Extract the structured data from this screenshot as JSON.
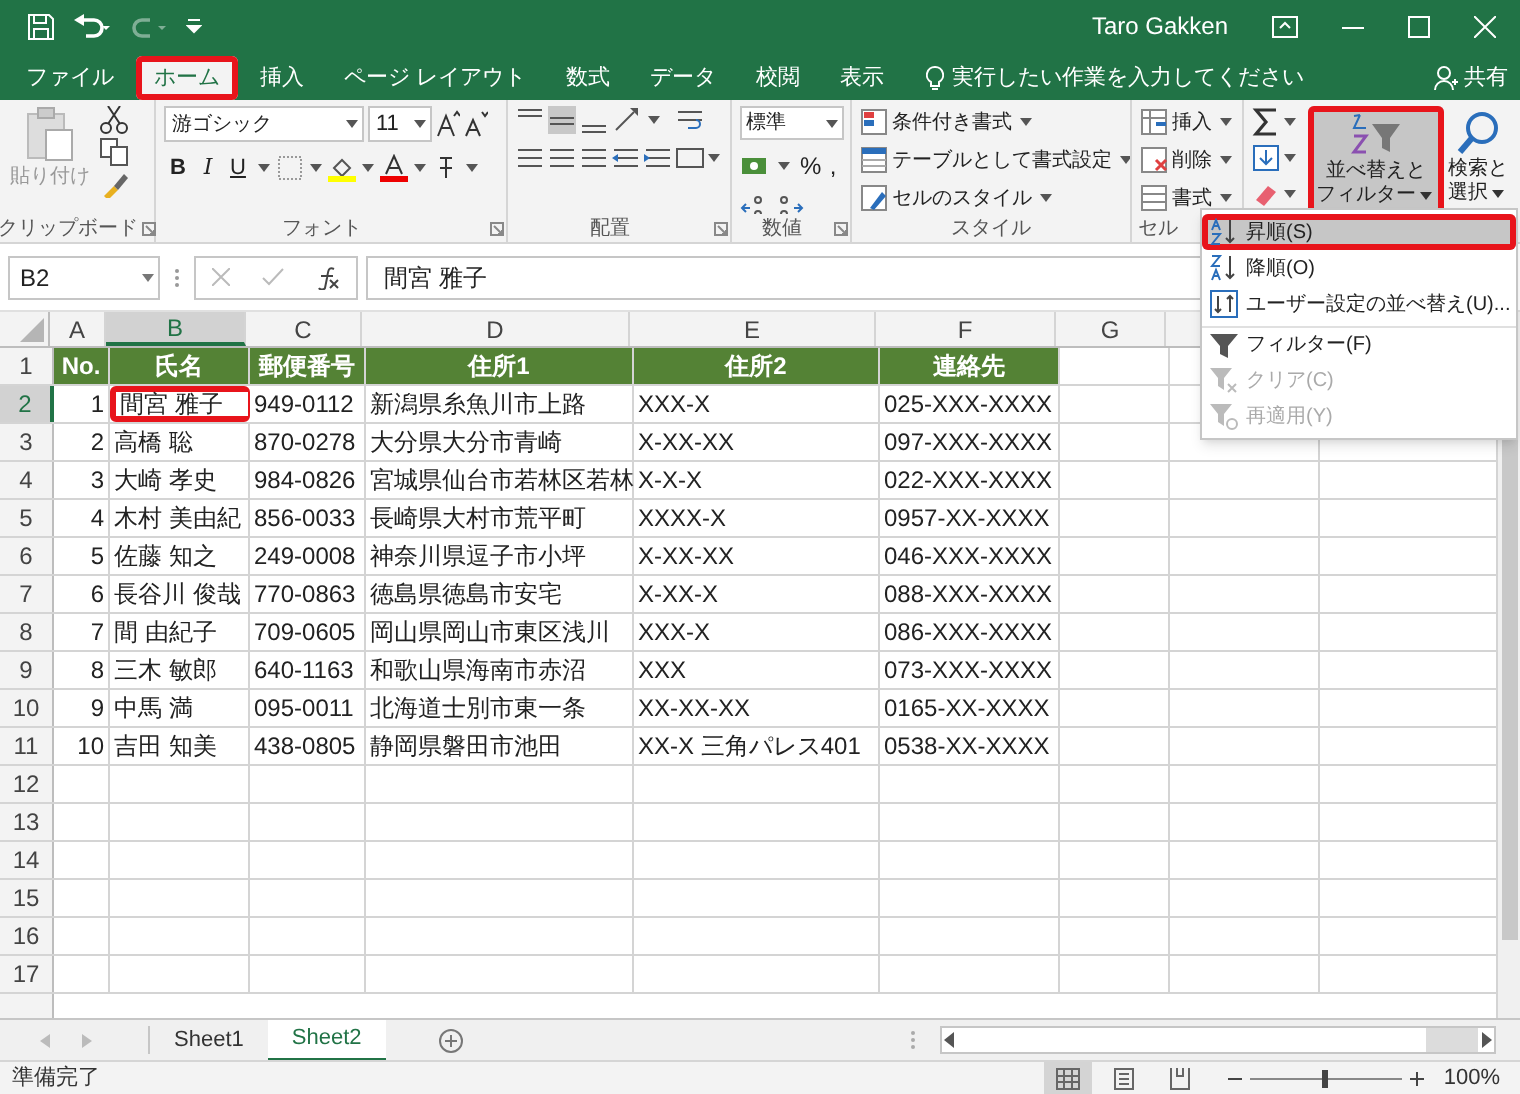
{
  "title_bar": {
    "user": "Taro Gakken"
  },
  "tabs": [
    {
      "label": "ファイル",
      "selected": false,
      "callout": false
    },
    {
      "label": "ホーム",
      "selected": true,
      "callout": true
    },
    {
      "label": "挿入",
      "selected": false,
      "callout": false
    },
    {
      "label": "ページ レイアウト",
      "selected": false,
      "callout": false
    },
    {
      "label": "数式",
      "selected": false,
      "callout": false
    },
    {
      "label": "データ",
      "selected": false,
      "callout": false
    },
    {
      "label": "校閲",
      "selected": false,
      "callout": false
    },
    {
      "label": "表示",
      "selected": false,
      "callout": false
    }
  ],
  "tell_me": {
    "placeholder": "実行したい作業を入力してください"
  },
  "share": "共有",
  "ribbon": {
    "clipboard": {
      "paste": "貼り付け",
      "group_label": "クリップボード"
    },
    "font": {
      "font_name": "游ゴシック",
      "font_size": "11",
      "format_buttons": [
        "B",
        "I",
        "U"
      ],
      "group_label": "フォント"
    },
    "alignment": {
      "group_label": "配置"
    },
    "number": {
      "format": "標準",
      "symbols": [
        "%",
        ","
      ],
      "group_label": "数値"
    },
    "styles": {
      "items": [
        "条件付き書式",
        "テーブルとして書式設定",
        "セルのスタイル"
      ],
      "group_label": "スタイル"
    },
    "cells": {
      "items": [
        "挿入",
        "削除",
        "書式"
      ],
      "group_label": "セル"
    },
    "editing": {
      "sort_filter": {
        "lines": [
          "並べ替えと",
          "フィルター"
        ],
        "callout": true
      },
      "find": {
        "lines": [
          "検索と",
          "選択"
        ]
      }
    }
  },
  "formula_bar": {
    "name_box": "B2",
    "formula": "間宮 雅子"
  },
  "columns": [
    {
      "letter": "A",
      "selected": false
    },
    {
      "letter": "B",
      "selected": true
    },
    {
      "letter": "C",
      "selected": false
    },
    {
      "letter": "D",
      "selected": false
    },
    {
      "letter": "E",
      "selected": false
    },
    {
      "letter": "F",
      "selected": false
    },
    {
      "letter": "G",
      "selected": false
    }
  ],
  "rows": [
    {
      "number": "1",
      "kind": "header",
      "selected": false,
      "callout": false,
      "cells": [
        "No.",
        "氏名",
        "郵便番号",
        "住所1",
        "住所2",
        "連絡先"
      ]
    },
    {
      "number": "2",
      "kind": "data",
      "selected": true,
      "callout": true,
      "cells": [
        "1",
        "間宮 雅子",
        "949-0112",
        "新潟県糸魚川市上路",
        "XXX-X",
        "025-XXX-XXXX"
      ]
    },
    {
      "number": "3",
      "kind": "data",
      "selected": false,
      "callout": false,
      "cells": [
        "2",
        "高橋 聡",
        "870-0278",
        "大分県大分市青崎",
        "X-XX-XX",
        "097-XXX-XXXX"
      ]
    },
    {
      "number": "4",
      "kind": "data",
      "selected": false,
      "callout": false,
      "cells": [
        "3",
        "大崎 孝史",
        "984-0826",
        "宮城県仙台市若林区若林",
        "X-X-X",
        "022-XXX-XXXX"
      ]
    },
    {
      "number": "5",
      "kind": "data",
      "selected": false,
      "callout": false,
      "cells": [
        "4",
        "木村 美由紀",
        "856-0033",
        "長崎県大村市荒平町",
        "XXXX-X",
        "0957-XX-XXXX"
      ]
    },
    {
      "number": "6",
      "kind": "data",
      "selected": false,
      "callout": false,
      "cells": [
        "5",
        "佐藤 知之",
        "249-0008",
        "神奈川県逗子市小坪",
        "X-XX-XX",
        "046-XXX-XXXX"
      ]
    },
    {
      "number": "7",
      "kind": "data",
      "selected": false,
      "callout": false,
      "cells": [
        "6",
        "長谷川 俊哉",
        "770-0863",
        "徳島県徳島市安宅",
        "X-XX-X",
        "088-XXX-XXXX"
      ]
    },
    {
      "number": "8",
      "kind": "data",
      "selected": false,
      "callout": false,
      "cells": [
        "7",
        "間 由紀子",
        "709-0605",
        "岡山県岡山市東区浅川",
        "XXX-X",
        "086-XXX-XXXX"
      ]
    },
    {
      "number": "9",
      "kind": "data",
      "selected": false,
      "callout": false,
      "cells": [
        "8",
        "三木 敏郎",
        "640-1163",
        "和歌山県海南市赤沼",
        "XXX",
        "073-XXX-XXXX"
      ]
    },
    {
      "number": "10",
      "kind": "data",
      "selected": false,
      "callout": false,
      "cells": [
        "9",
        "中馬 満",
        "095-0011",
        "北海道士別市東一条",
        "XX-XX-XX",
        "0165-XX-XXXX"
      ]
    },
    {
      "number": "11",
      "kind": "data",
      "selected": false,
      "callout": false,
      "cells": [
        "10",
        "吉田 知美",
        "438-0805",
        "静岡県磐田市池田",
        "XX-X 三角パレス401",
        "0538-XX-XXXX"
      ]
    }
  ],
  "empty_rows": [
    "12",
    "13",
    "14",
    "15",
    "16",
    "17"
  ],
  "sort_menu": {
    "items": [
      {
        "label": "昇順(S)",
        "kind": "sort_ascending",
        "selected": true,
        "disabled": false,
        "callout": true,
        "divider_before": false
      },
      {
        "label": "降順(O)",
        "kind": "sort_descending",
        "selected": false,
        "disabled": false,
        "callout": false,
        "divider_before": false
      },
      {
        "label": "ユーザー設定の並べ替え(U)...",
        "kind": "custom_sort",
        "selected": false,
        "disabled": false,
        "callout": false,
        "divider_before": false
      },
      {
        "label": "フィルター(F)",
        "kind": "filter",
        "selected": false,
        "disabled": false,
        "callout": false,
        "divider_before": true
      },
      {
        "label": "クリア(C)",
        "kind": "clear",
        "selected": false,
        "disabled": true,
        "callout": false,
        "divider_before": false
      },
      {
        "label": "再適用(Y)",
        "kind": "reapply",
        "selected": false,
        "disabled": true,
        "callout": false,
        "divider_before": false
      }
    ]
  },
  "sheet_tabs": [
    {
      "label": "Sheet1",
      "selected": false
    },
    {
      "label": "Sheet2",
      "selected": true
    }
  ],
  "status_bar": {
    "text": "準備完了",
    "views": [
      {
        "kind": "normal",
        "selected": true
      },
      {
        "kind": "page_layout",
        "selected": false
      },
      {
        "kind": "page_break",
        "selected": false
      }
    ],
    "zoom": {
      "level": 0.5
    },
    "zoom_text": "100%"
  }
}
